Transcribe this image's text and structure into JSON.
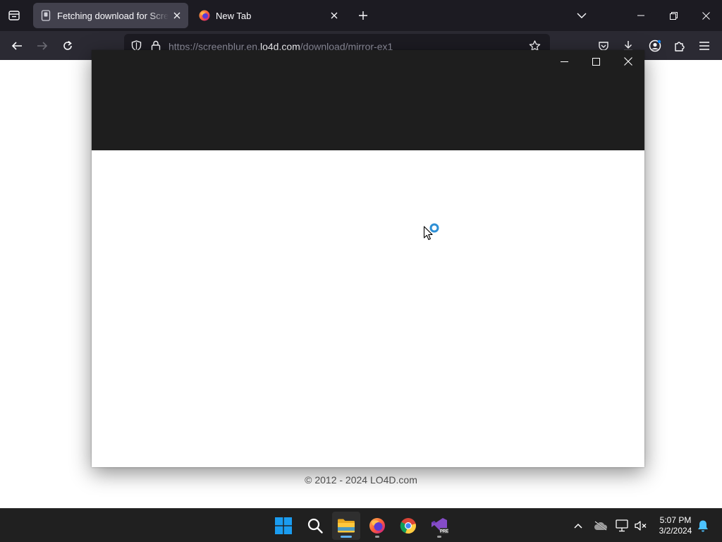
{
  "browser": {
    "tabs": [
      {
        "title": "Fetching download for Screen Blur",
        "active": true
      },
      {
        "title": "New Tab",
        "active": false
      }
    ],
    "url": {
      "prefix": "https://screenblur.en.",
      "domain": "lo4d.com",
      "path": "/download/mirror-ex1"
    }
  },
  "page": {
    "footer": "© 2012 - 2024 LO4D.com"
  },
  "taskbar": {
    "apps": [
      "start",
      "search",
      "file-explorer",
      "firefox",
      "chrome",
      "visual-studio-preview"
    ],
    "clock": {
      "time": "5:07 PM",
      "date": "3/2/2024"
    }
  },
  "colors": {
    "accent": "#0a84ff",
    "loading": "#2d8fd5",
    "start_blue": "#1a9cf0",
    "folder_yellow": "#ffc83d",
    "vs_purple": "#854cc7"
  }
}
